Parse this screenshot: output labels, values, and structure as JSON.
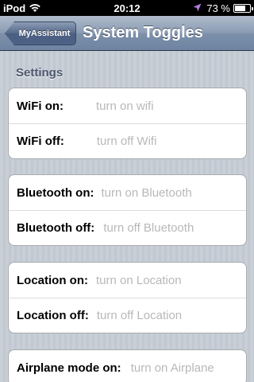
{
  "status_bar": {
    "carrier": "iPod",
    "time": "20:12",
    "battery_percent_text": "73 %",
    "battery_level": 0.73,
    "icons": [
      "wifi-icon",
      "location-arrow-icon",
      "battery-icon"
    ]
  },
  "nav": {
    "back_label": "MyAssistant",
    "title": "System Toggles"
  },
  "section": {
    "header": "Settings"
  },
  "groups": [
    {
      "rows": [
        {
          "label": "WiFi on:",
          "value": "turn on wifi"
        },
        {
          "label": "WiFi off:",
          "value": "turn off Wifi"
        }
      ]
    },
    {
      "rows": [
        {
          "label": "Bluetooth on:",
          "value": "turn on Bluetooth"
        },
        {
          "label": "Bluetooth off:",
          "value": "turn off Bluetooth"
        }
      ]
    },
    {
      "rows": [
        {
          "label": "Location on:",
          "value": "turn on Location"
        },
        {
          "label": "Location off:",
          "value": "turn off Location"
        }
      ]
    },
    {
      "rows": [
        {
          "label": "Airplane mode on:",
          "value": "turn on Airplane"
        }
      ]
    }
  ],
  "colors": {
    "nav_bar": "#7d90aa",
    "background": "#c5ccd4",
    "section_header": "#4c566c",
    "value_text": "#b8b8b8"
  }
}
